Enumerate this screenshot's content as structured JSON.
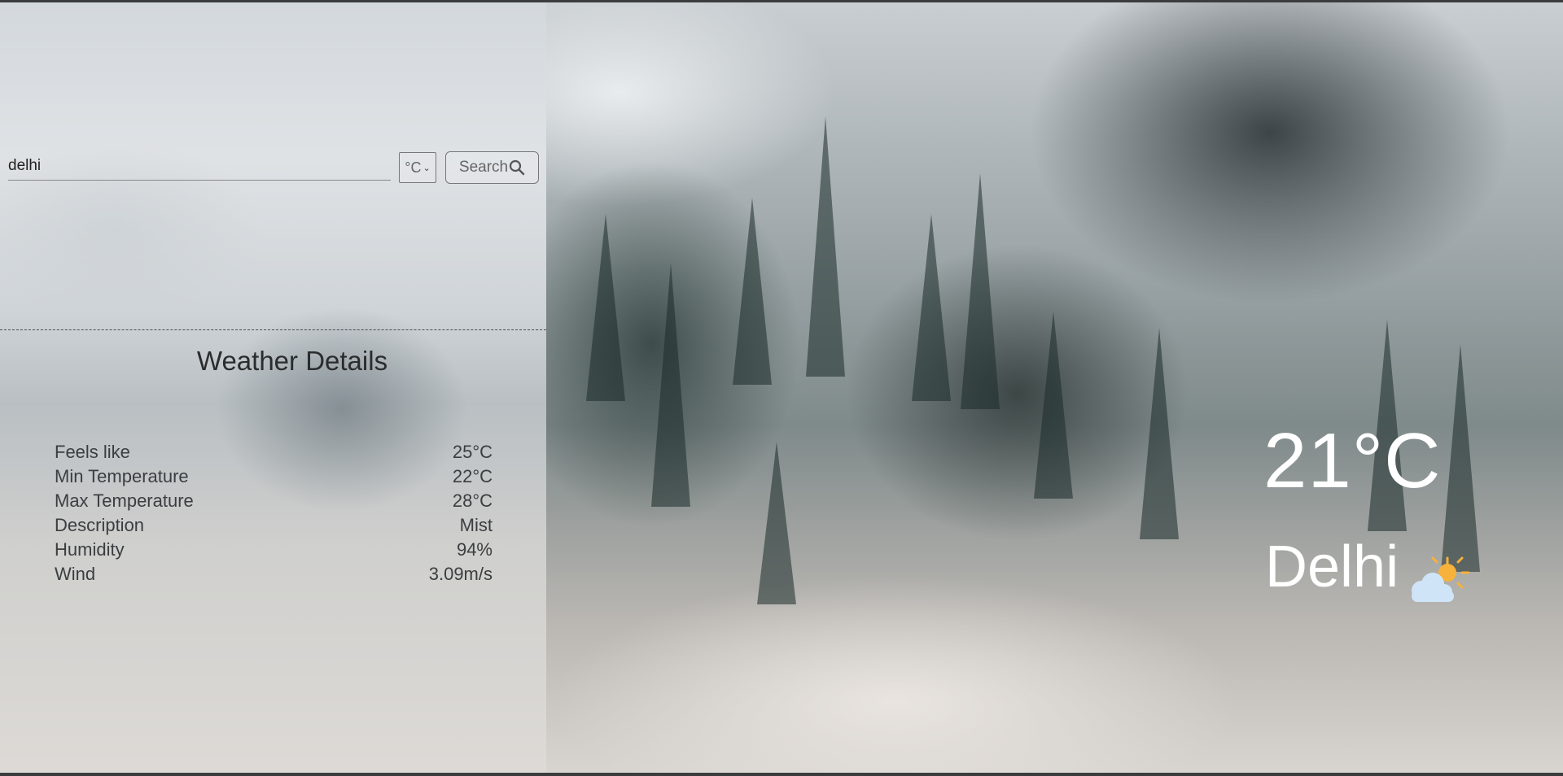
{
  "search": {
    "value": "delhi",
    "unit": "°C",
    "button_label": "Search"
  },
  "details": {
    "title": "Weather Details",
    "rows": [
      {
        "label": "Feels like",
        "value": "25°C"
      },
      {
        "label": "Min Temperature",
        "value": "22°C"
      },
      {
        "label": "Max Temperature",
        "value": "28°C"
      },
      {
        "label": "Description",
        "value": "Mist"
      },
      {
        "label": "Humidity",
        "value": "94%"
      },
      {
        "label": "Wind",
        "value": "3.09m/s"
      }
    ]
  },
  "current": {
    "temperature": "21°C",
    "city": "Delhi",
    "icon": "partly-cloudy-sun-icon"
  },
  "colors": {
    "cloud": "#cfe5f7",
    "sun": "#f6b23b"
  }
}
